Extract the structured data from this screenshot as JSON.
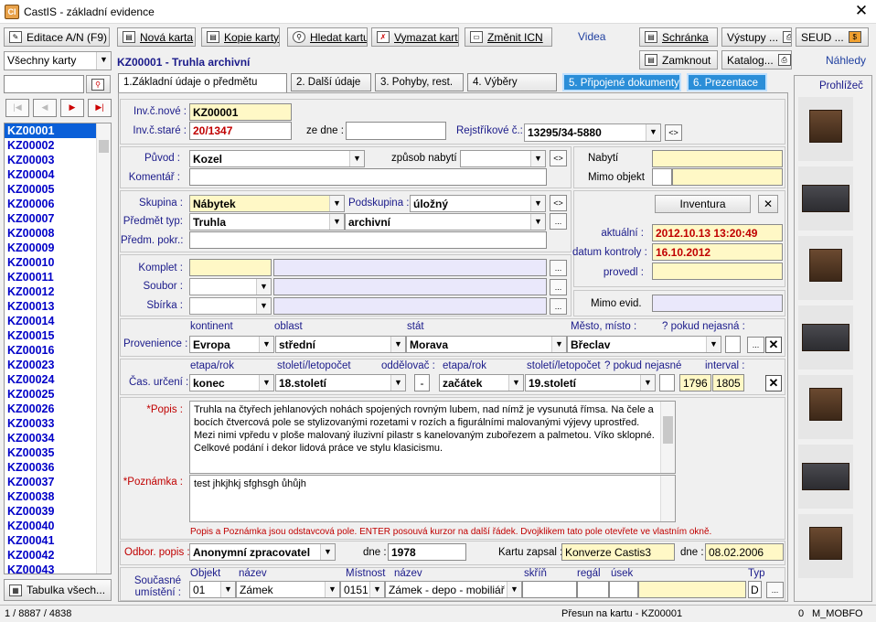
{
  "window": {
    "title": "CastIS - základní evidence",
    "app_icon": "castis-logo-icon"
  },
  "toolbar": {
    "editace": "Editace A/N (F9)",
    "nova": "Nová karta",
    "kopie": "Kopie karty",
    "hledat": "Hledat kartu",
    "vymazat": "Vymazat kartu",
    "zmenit": "Změnit ICN",
    "videa": "Videa",
    "schranka": "Schránka",
    "vystupy": "Výstupy ...",
    "seud": "SEUD ...",
    "zamknout": "Zamknout",
    "katalog": "Katalog...",
    "nahledy": "Náhledy"
  },
  "left": {
    "filter": "Všechny karty",
    "search_value": "",
    "items": [
      "KZ00001",
      "KZ00002",
      "KZ00003",
      "KZ00004",
      "KZ00005",
      "KZ00006",
      "KZ00007",
      "KZ00008",
      "KZ00009",
      "KZ00010",
      "KZ00011",
      "KZ00012",
      "KZ00013",
      "KZ00014",
      "KZ00015",
      "KZ00016",
      "KZ00023",
      "KZ00024",
      "KZ00025",
      "KZ00026",
      "KZ00033",
      "KZ00034",
      "KZ00035",
      "KZ00036",
      "KZ00037",
      "KZ00038",
      "KZ00039",
      "KZ00040",
      "KZ00041",
      "KZ00042",
      "KZ00043"
    ],
    "selected": "KZ00001",
    "tabulka": "Tabulka všech..."
  },
  "record": {
    "heading": "KZ00001 - Truhla archivní"
  },
  "tabs": [
    "1.Základní údaje o předmětu",
    "2. Další údaje",
    "3. Pohyby, rest.",
    "4. Výběry",
    "5. Připojené dokumenty",
    "6. Prezentace"
  ],
  "ident": {
    "inv_nove_label": "Inv.č.nové :",
    "inv_nove": "KZ00001",
    "inv_stare_label": "Inv.č.staré :",
    "inv_stare": "20/1347",
    "ze_dne_label": "ze dne :",
    "ze_dne": "",
    "rejstrik_label": "Rejstříkové č.:",
    "rejstrik": "13295/34-5880"
  },
  "origin": {
    "puvod_label": "Původ :",
    "puvod": "Kozel",
    "zpusob_label": "způsob nabytí :",
    "zpusob": "",
    "komentar_label": "Komentář :",
    "komentar": "",
    "nabyti_label": "Nabytí",
    "nabyti": "",
    "mimo_label": "Mimo objekt",
    "mimo": ""
  },
  "classif": {
    "skupina_label": "Skupina :",
    "skupina": "Nábytek",
    "podskupina_label": "Podskupina :",
    "podskupina": "úložný",
    "predmet_label": "Předmět typ:",
    "predmet": "Truhla",
    "predmet2": "archivní",
    "pokr_label": "Předm. pokr.:",
    "pokr": ""
  },
  "inventura": {
    "button": "Inventura",
    "aktualni_label": "aktuální :",
    "aktualni": "2012.10.13 13:20:49",
    "kontrola_label": "datum kontroly :",
    "kontrola": "16.10.2012",
    "provedl_label": "provedl :",
    "provedl": ""
  },
  "komplet": {
    "komplet_label": "Komplet :",
    "soubor_label": "Soubor :",
    "sbirka_label": "Sbírka :",
    "mimo_evid_label": "Mimo evid.",
    "mimo_evid": ""
  },
  "provenience": {
    "label": "Provenience :",
    "h_kontinent": "kontinent",
    "h_oblast": "oblast",
    "h_stat": "stát",
    "h_mesto": "Město, místo :",
    "h_nejasna": "? pokud nejasná :",
    "kontinent": "Evropa",
    "oblast": "střední",
    "stat": "Morava",
    "mesto": "Břeclav"
  },
  "cas": {
    "label": "Čas. určení :",
    "h_etapa1": "etapa/rok",
    "h_stoleti1": "století/letopočet",
    "h_oddelovac": "oddělovač :",
    "h_etapa2": "etapa/rok",
    "h_stoleti2": "století/letopočet",
    "h_nejasne": "? pokud nejasné",
    "h_interval": "interval :",
    "etapa1": "konec",
    "stoleti1": "18.století",
    "oddelovac": "-",
    "etapa2": "začátek",
    "stoleti2": "19.století",
    "rok_od": "1796",
    "rok_do": "1805"
  },
  "popis": {
    "label": "*Popis :",
    "text": "Truhla na čtyřech jehlanových nohách spojených rovným lubem, nad nímž je vysunutá římsa. Na čele a bocích čtvercová pole se stylizovanými rozetami v rozích a figurálními malovanými výjevy uprostřed. Mezi nimi vpředu v ploše malovaný iluzivní pilastr s kanelovaným zubořezem a palmetou. Víko sklopné. Celkové podání i dekor lidová práce ve stylu klasicismu.",
    "poznamka_label": "*Poznámka :",
    "poznamka": "test jhkjhkj sfghsgh ůhůjh",
    "hint": "Popis a Poznámka jsou odstavcová pole. ENTER posouvá kurzor na další řádek. Dvojklikem tato pole otevřete ve vlastním okně."
  },
  "odbor": {
    "label": "Odbor. popis :",
    "value": "Anonymní zpracovatel",
    "dne_label": "dne :",
    "dne": "1978",
    "zapsal_label": "Kartu zapsal :",
    "zapsal": "Konverze Castis3",
    "dne2_label": "dne :",
    "dne2": "08.02.2006"
  },
  "umisteni": {
    "label1": "Současné",
    "label2": "umístění :",
    "h_objekt": "Objekt",
    "h_nazev": "název",
    "h_mistnost": "Místnost",
    "h_nazev2": "název",
    "h_skrin": "skříň",
    "h_regal": "regál",
    "h_usek": "úsek",
    "h_typ": "Typ",
    "objekt": "01",
    "nazev": "Zámek",
    "mistnost": "0151",
    "nazev2": "Zámek - depo - mobiliář",
    "typ": "D"
  },
  "right": {
    "prohlizec": "Prohlížeč"
  },
  "status": {
    "pos": "1 / 8887 / 4838",
    "msg": "Přesun na kartu - KZ00001",
    "zero": "0",
    "user": "M_MOBFO"
  }
}
